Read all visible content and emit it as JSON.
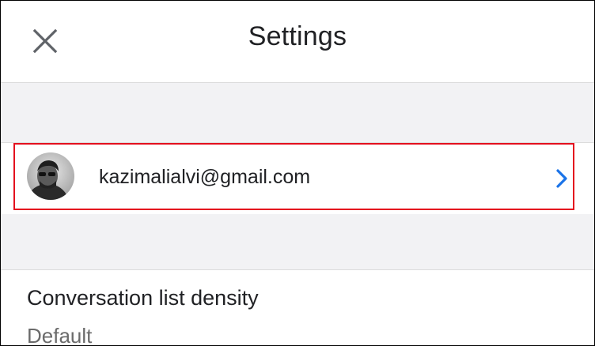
{
  "header": {
    "title": "Settings",
    "close_icon": "close-icon"
  },
  "account": {
    "email": "kazimalialvi@gmail.com",
    "avatar_icon": "user-avatar",
    "chevron_icon": "chevron-right-icon",
    "highlight_color": "#e4101e",
    "chevron_color": "#1a73e8"
  },
  "settings": [
    {
      "label": "Conversation list density",
      "value": "Default"
    }
  ]
}
